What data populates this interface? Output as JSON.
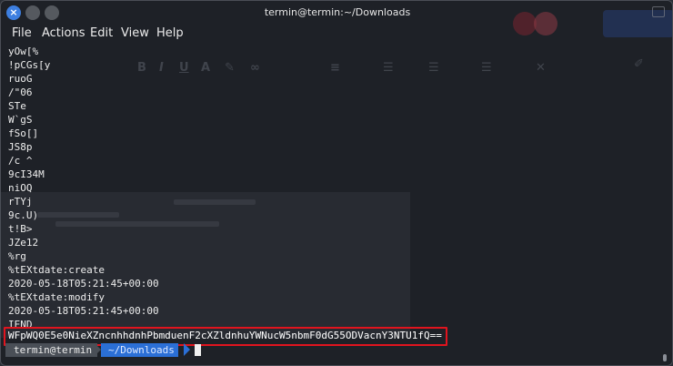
{
  "window": {
    "title": "termin@termin:~/Downloads",
    "close_glyph": "×"
  },
  "menu": [
    "File",
    "Actions",
    "Edit",
    "View",
    "Help"
  ],
  "terminal_lines": [
    "yOw[%",
    "!pCGs[y",
    "ruoG",
    "/\"06",
    "STe",
    "W`gS",
    "fSo[]",
    "JS8p",
    "/c ^",
    "9cI34M",
    "niOQ",
    "rTYj",
    "9c.U)",
    "t!B>",
    "JZe12",
    "%rg",
    "%tEXtdate:create",
    "2020-05-18T05:21:45+00:00",
    "%tEXtdate:modify",
    "2020-05-18T05:21:45+00:00",
    "IEND"
  ],
  "highlighted_line": "WFpWQ0E5e0NieXZncnhhdnhPbmduenF2cXZldnhuYWNucW5nbmF0dG55ODVacnY3NTU1fQ==",
  "prompt": {
    "user_host": "termin@termin",
    "directory": "~/Downloads"
  },
  "colors": {
    "highlight_border": "#e0141e",
    "prompt_dir_bg": "#2b6fd6",
    "close_button": "#3d7fe0"
  }
}
